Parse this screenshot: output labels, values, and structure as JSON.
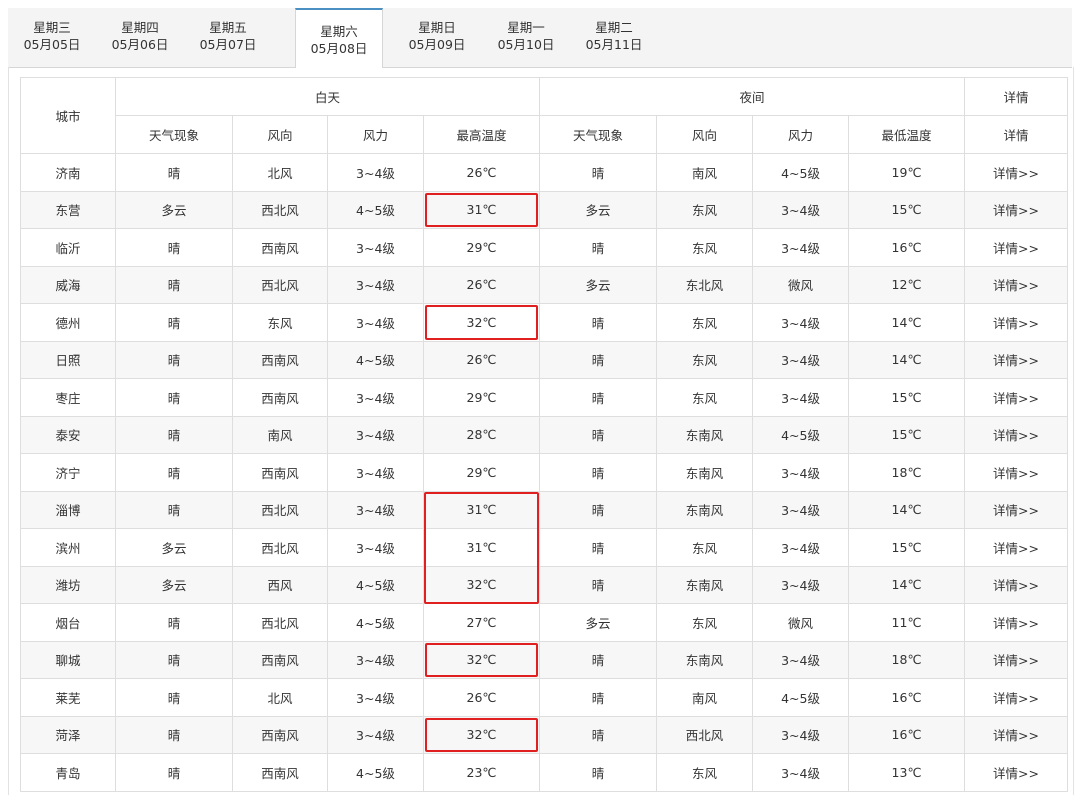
{
  "tabs": [
    {
      "weekday": "星期三",
      "date": "05月05日",
      "active": false
    },
    {
      "weekday": "星期四",
      "date": "05月06日",
      "active": false
    },
    {
      "weekday": "星期五",
      "date": "05月07日",
      "active": false
    },
    {
      "weekday": "星期六",
      "date": "05月08日",
      "active": true
    },
    {
      "weekday": "星期日",
      "date": "05月09日",
      "active": false
    },
    {
      "weekday": "星期一",
      "date": "05月10日",
      "active": false
    },
    {
      "weekday": "星期二",
      "date": "05月11日",
      "active": false
    }
  ],
  "table": {
    "header": {
      "city": "城市",
      "day": "白天",
      "night": "夜间",
      "detail": "详情",
      "day_cols": [
        "天气现象",
        "风向",
        "风力",
        "最高温度"
      ],
      "night_cols": [
        "天气现象",
        "风向",
        "风力",
        "最低温度"
      ],
      "detail_col": "详情"
    },
    "highlight_color": "#e02020",
    "rows": [
      {
        "city": "济南",
        "day_weather": "晴",
        "day_wind_dir": "北风",
        "day_wind_force": "3~4级",
        "high": "26℃",
        "night_weather": "晴",
        "night_wind_dir": "南风",
        "night_wind_force": "4~5级",
        "low": "19℃",
        "detail": "详情>>",
        "highlight": false
      },
      {
        "city": "东营",
        "day_weather": "多云",
        "day_wind_dir": "西北风",
        "day_wind_force": "4~5级",
        "high": "31℃",
        "night_weather": "多云",
        "night_wind_dir": "东风",
        "night_wind_force": "3~4级",
        "low": "15℃",
        "detail": "详情>>",
        "highlight": true
      },
      {
        "city": "临沂",
        "day_weather": "晴",
        "day_wind_dir": "西南风",
        "day_wind_force": "3~4级",
        "high": "29℃",
        "night_weather": "晴",
        "night_wind_dir": "东风",
        "night_wind_force": "3~4级",
        "low": "16℃",
        "detail": "详情>>",
        "highlight": false
      },
      {
        "city": "威海",
        "day_weather": "晴",
        "day_wind_dir": "西北风",
        "day_wind_force": "3~4级",
        "high": "26℃",
        "night_weather": "多云",
        "night_wind_dir": "东北风",
        "night_wind_force": "微风",
        "low": "12℃",
        "detail": "详情>>",
        "highlight": false
      },
      {
        "city": "德州",
        "day_weather": "晴",
        "day_wind_dir": "东风",
        "day_wind_force": "3~4级",
        "high": "32℃",
        "night_weather": "晴",
        "night_wind_dir": "东风",
        "night_wind_force": "3~4级",
        "low": "14℃",
        "detail": "详情>>",
        "highlight": true
      },
      {
        "city": "日照",
        "day_weather": "晴",
        "day_wind_dir": "西南风",
        "day_wind_force": "4~5级",
        "high": "26℃",
        "night_weather": "晴",
        "night_wind_dir": "东风",
        "night_wind_force": "3~4级",
        "low": "14℃",
        "detail": "详情>>",
        "highlight": false
      },
      {
        "city": "枣庄",
        "day_weather": "晴",
        "day_wind_dir": "西南风",
        "day_wind_force": "3~4级",
        "high": "29℃",
        "night_weather": "晴",
        "night_wind_dir": "东风",
        "night_wind_force": "3~4级",
        "low": "15℃",
        "detail": "详情>>",
        "highlight": false
      },
      {
        "city": "泰安",
        "day_weather": "晴",
        "day_wind_dir": "南风",
        "day_wind_force": "3~4级",
        "high": "28℃",
        "night_weather": "晴",
        "night_wind_dir": "东南风",
        "night_wind_force": "4~5级",
        "low": "15℃",
        "detail": "详情>>",
        "highlight": false
      },
      {
        "city": "济宁",
        "day_weather": "晴",
        "day_wind_dir": "西南风",
        "day_wind_force": "3~4级",
        "high": "29℃",
        "night_weather": "晴",
        "night_wind_dir": "东南风",
        "night_wind_force": "3~4级",
        "low": "18℃",
        "detail": "详情>>",
        "highlight": false
      },
      {
        "city": "淄博",
        "day_weather": "晴",
        "day_wind_dir": "西北风",
        "day_wind_force": "3~4级",
        "high": "31℃",
        "night_weather": "晴",
        "night_wind_dir": "东南风",
        "night_wind_force": "3~4级",
        "low": "14℃",
        "detail": "详情>>",
        "highlight": "group"
      },
      {
        "city": "滨州",
        "day_weather": "多云",
        "day_wind_dir": "西北风",
        "day_wind_force": "3~4级",
        "high": "31℃",
        "night_weather": "晴",
        "night_wind_dir": "东风",
        "night_wind_force": "3~4级",
        "low": "15℃",
        "detail": "详情>>",
        "highlight": "group"
      },
      {
        "city": "潍坊",
        "day_weather": "多云",
        "day_wind_dir": "西风",
        "day_wind_force": "4~5级",
        "high": "32℃",
        "night_weather": "晴",
        "night_wind_dir": "东南风",
        "night_wind_force": "3~4级",
        "low": "14℃",
        "detail": "详情>>",
        "highlight": "group"
      },
      {
        "city": "烟台",
        "day_weather": "晴",
        "day_wind_dir": "西北风",
        "day_wind_force": "4~5级",
        "high": "27℃",
        "night_weather": "多云",
        "night_wind_dir": "东风",
        "night_wind_force": "微风",
        "low": "11℃",
        "detail": "详情>>",
        "highlight": false
      },
      {
        "city": "聊城",
        "day_weather": "晴",
        "day_wind_dir": "西南风",
        "day_wind_force": "3~4级",
        "high": "32℃",
        "night_weather": "晴",
        "night_wind_dir": "东南风",
        "night_wind_force": "3~4级",
        "low": "18℃",
        "detail": "详情>>",
        "highlight": true
      },
      {
        "city": "莱芜",
        "day_weather": "晴",
        "day_wind_dir": "北风",
        "day_wind_force": "3~4级",
        "high": "26℃",
        "night_weather": "晴",
        "night_wind_dir": "南风",
        "night_wind_force": "4~5级",
        "low": "16℃",
        "detail": "详情>>",
        "highlight": false
      },
      {
        "city": "菏泽",
        "day_weather": "晴",
        "day_wind_dir": "西南风",
        "day_wind_force": "3~4级",
        "high": "32℃",
        "night_weather": "晴",
        "night_wind_dir": "西北风",
        "night_wind_force": "3~4级",
        "low": "16℃",
        "detail": "详情>>",
        "highlight": true
      },
      {
        "city": "青岛",
        "day_weather": "晴",
        "day_wind_dir": "西南风",
        "day_wind_force": "4~5级",
        "high": "23℃",
        "night_weather": "晴",
        "night_wind_dir": "东风",
        "night_wind_force": "3~4级",
        "low": "13℃",
        "detail": "详情>>",
        "highlight": false
      }
    ]
  }
}
